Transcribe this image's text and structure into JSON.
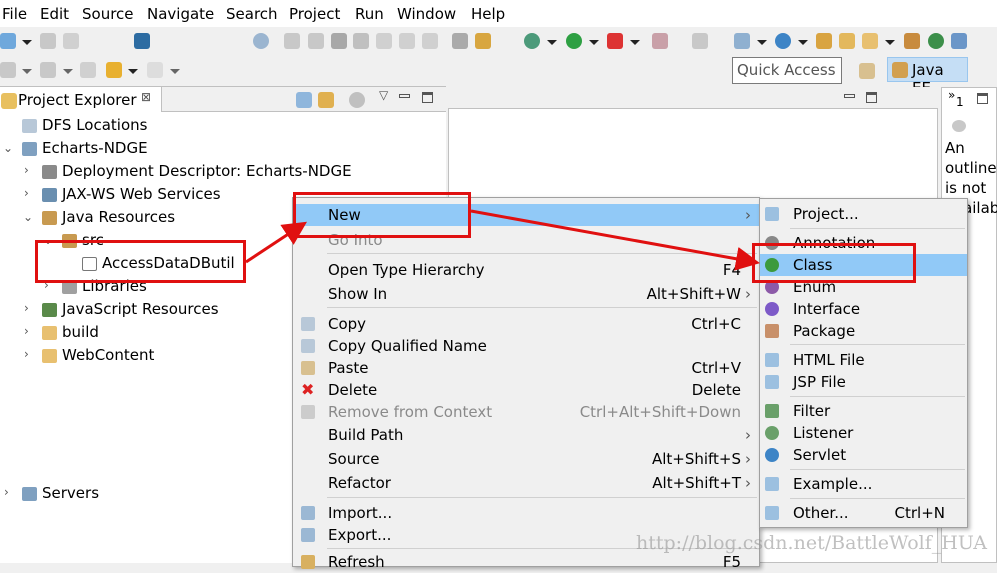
{
  "menubar": [
    "File",
    "Edit",
    "Source",
    "Navigate",
    "Search",
    "Project",
    "Run",
    "Window",
    "Help"
  ],
  "toolbar": {
    "quick_access_placeholder": "Quick Access",
    "perspective": "Java EE"
  },
  "project_explorer": {
    "title": "Project Explorer",
    "items": [
      {
        "label": "DFS Locations",
        "icon": "dfs-icon",
        "level": 0
      },
      {
        "label": "Echarts-NDGE",
        "icon": "web-project-icon",
        "level": 0,
        "expanded": true
      },
      {
        "label": "Deployment Descriptor: Echarts-NDGE",
        "icon": "deployment-descriptor-icon",
        "level": 1
      },
      {
        "label": "JAX-WS Web Services",
        "icon": "webservices-icon",
        "level": 1
      },
      {
        "label": "Java Resources",
        "icon": "java-resources-icon",
        "level": 1,
        "expanded": true
      },
      {
        "label": "src",
        "icon": "source-folder-icon",
        "level": 2,
        "expanded": true
      },
      {
        "label": "AccessDataDButil",
        "icon": "package-icon",
        "level": 3
      },
      {
        "label": "Libraries",
        "icon": "libraries-icon",
        "level": 2
      },
      {
        "label": "JavaScript Resources",
        "icon": "js-resources-icon",
        "level": 1
      },
      {
        "label": "build",
        "icon": "folder-icon",
        "level": 1
      },
      {
        "label": "WebContent",
        "icon": "folder-icon",
        "level": 1
      },
      {
        "label": "Servers",
        "icon": "folder-icon",
        "level": 0
      }
    ]
  },
  "outline": {
    "tab_count": "1",
    "message": [
      "An",
      "outline",
      "is not",
      "availab"
    ]
  },
  "context_menu": {
    "items": [
      {
        "label": "New",
        "submenu": true,
        "highlighted": true
      },
      {
        "label": "Go Into",
        "disabled": true
      },
      {
        "label": "Open Type Hierarchy",
        "shortcut": "F4"
      },
      {
        "label": "Show In",
        "shortcut": "Alt+Shift+W",
        "submenu": true
      },
      {
        "label": "Copy",
        "shortcut": "Ctrl+C",
        "icon": "copy-icon"
      },
      {
        "label": "Copy Qualified Name",
        "icon": "copy-icon"
      },
      {
        "label": "Paste",
        "shortcut": "Ctrl+V",
        "icon": "paste-icon"
      },
      {
        "label": "Delete",
        "shortcut": "Delete",
        "icon": "delete-icon"
      },
      {
        "label": "Remove from Context",
        "shortcut": "Ctrl+Alt+Shift+Down",
        "disabled": true,
        "icon": "remove-icon"
      },
      {
        "label": "Build Path",
        "submenu": true
      },
      {
        "label": "Source",
        "shortcut": "Alt+Shift+S",
        "submenu": true
      },
      {
        "label": "Refactor",
        "shortcut": "Alt+Shift+T",
        "submenu": true
      },
      {
        "label": "Import...",
        "icon": "import-icon"
      },
      {
        "label": "Export...",
        "icon": "export-icon"
      },
      {
        "label": "Refresh",
        "shortcut": "F5",
        "icon": "refresh-icon"
      }
    ]
  },
  "new_submenu": {
    "items": [
      {
        "label": "Project...",
        "icon": "new-project-icon"
      },
      {
        "label": "Annotation",
        "icon": "annotation-icon"
      },
      {
        "label": "Class",
        "icon": "class-icon",
        "highlighted": true
      },
      {
        "label": "Enum",
        "icon": "enum-icon"
      },
      {
        "label": "Interface",
        "icon": "interface-icon"
      },
      {
        "label": "Package",
        "icon": "package-icon"
      },
      {
        "label": "HTML File",
        "icon": "html-file-icon"
      },
      {
        "label": "JSP File",
        "icon": "jsp-file-icon"
      },
      {
        "label": "Filter",
        "icon": "filter-icon"
      },
      {
        "label": "Listener",
        "icon": "listener-icon"
      },
      {
        "label": "Servlet",
        "icon": "servlet-icon"
      },
      {
        "label": "Example...",
        "icon": "example-icon"
      },
      {
        "label": "Other...",
        "shortcut": "Ctrl+N",
        "icon": "wizard-icon"
      }
    ]
  },
  "annotation_color": "#e01010",
  "highlight_color": "#91c9f7",
  "watermark": "http://blog.csdn.net/BattleWolf_HUA"
}
